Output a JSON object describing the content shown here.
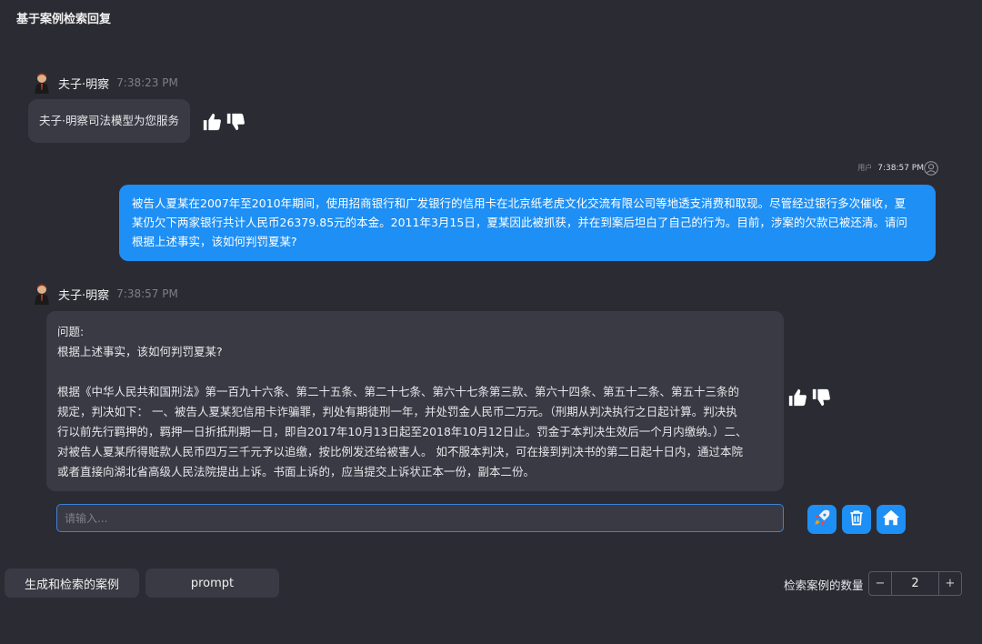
{
  "header": {
    "title": "基于案例检索回复"
  },
  "messages": {
    "bot1": {
      "name": "夫子·明察",
      "time": "7:38:23 PM",
      "text": "夫子·明察司法模型为您服务"
    },
    "user1": {
      "label": "用户",
      "time": "7:38:57 PM",
      "lines": [
        "被告人夏某在2007年至2010年期间，使用招商银行和广发银行的信用卡在北京纸老虎文化交流有限公司等地透支消费和取现。尽管经过银行多次催收，夏",
        "某仍欠下两家银行共计人民币26379.85元的本金。2011年3月15日，夏某因此被抓获，并在到案后坦白了自己的行为。目前，涉案的欠款已被还清。请问",
        "根据上述事实，该如何判罚夏某?"
      ]
    },
    "bot2": {
      "name": "夫子·明察",
      "time": "7:38:57 PM",
      "lines": [
        "问题:",
        "根据上述事实，该如何判罚夏某?",
        "",
        "根据《中华人民共和国刑法》第一百九十六条、第二十五条、第二十七条、第六十七条第三款、第六十四条、第五十二条、第五十三条的",
        "规定，判决如下：  一、被告人夏某犯信用卡诈骗罪，判处有期徒刑一年，并处罚金人民币二万元。（刑期从判决执行之日起计算。判决执",
        "行以前先行羁押的，羁押一日折抵刑期一日，即自2017年10月13日起至2018年10月12日止。罚金于本判决生效后一个月内缴纳。）二、",
        "对被告人夏某所得赃款人民币四万三千元予以追缴，按比例发还给被害人。  如不服本判决，可在接到判决书的第二日起十日内，通过本院",
        "或者直接向湖北省高级人民法院提出上诉。书面上诉的，应当提交上诉状正本一份，副本二份。"
      ]
    }
  },
  "input": {
    "placeholder": "请输入..."
  },
  "actions": {
    "submit_icon": "rocket-icon",
    "clear_icon": "trash-icon",
    "home_icon": "home-icon"
  },
  "tabs": {
    "cases_label": "生成和检索的案例",
    "prompt_label": "prompt"
  },
  "counter": {
    "label": "检索案例的数量",
    "minus": "−",
    "value": "2",
    "plus": "+"
  },
  "colors": {
    "background": "#2b2b33",
    "bubble": "#3a3a44",
    "accent": "#1e8ff4"
  }
}
